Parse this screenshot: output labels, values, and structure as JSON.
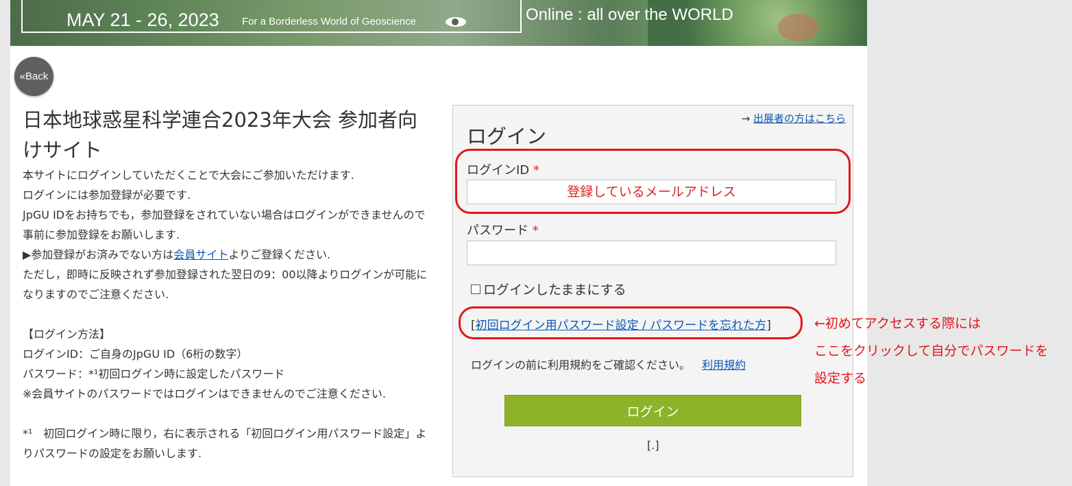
{
  "banner": {
    "date": "MAY 21 - 26, 2023",
    "tagline": "For a Borderless World of Geoscience",
    "online": "Online : all over the WORLD"
  },
  "back_button": "«Back",
  "intro": {
    "title": "日本地球惑星科学連合2023年大会 参加者向けサイト",
    "lines": [
      "本サイトにログインしていただくことで大会にご参加いただけます.",
      "ログインには参加登録が必要です.",
      "JpGU IDをお持ちでも，参加登録をされていない場合はログインができませんので事前に参加登録をお願いします.",
      "▶参加登録がお済みでない方は",
      "会員サイト",
      "よりご登録ください.",
      "ただし，即時に反映されず参加登録された翌日の9：00以降よりログインが可能になりますのでご注意ください.",
      "【ログイン方法】",
      "ログインID：ご自身のJpGU ID（6桁の数字）",
      "パスワード：*¹初回ログイン時に設定したパスワード",
      "※会員サイトのパスワードではログインはできませんのでご注意ください.",
      "*¹　初回ログイン時に限り，右に表示される「初回ログイン用パスワード設定」よりパスワードの設定をお願いします."
    ]
  },
  "login": {
    "exhibitor_arrow": "→",
    "exhibitor_link": "出展者の方はこちら",
    "heading": "ログイン",
    "id_label": "ログインID",
    "required_mark": "*",
    "id_value": "登録しているメールアドレス",
    "password_label": "パスワード",
    "password_value": "",
    "remember_label": "ログインしたままにする",
    "reset_open": "[",
    "reset_link": "初回ログイン用パスワード設定 / パスワードを忘れた方",
    "reset_close": "]",
    "terms_text": "ログインの前に利用規約をご確認ください。",
    "terms_link": "利用規約",
    "submit_label": "ログイン",
    "bracket_text": "[.]"
  },
  "annotation": {
    "line1": "←初めてアクセスする際には",
    "line2": "ここをクリックして自分でパスワードを",
    "line3": "設定する",
    "color": "#e3141b"
  }
}
